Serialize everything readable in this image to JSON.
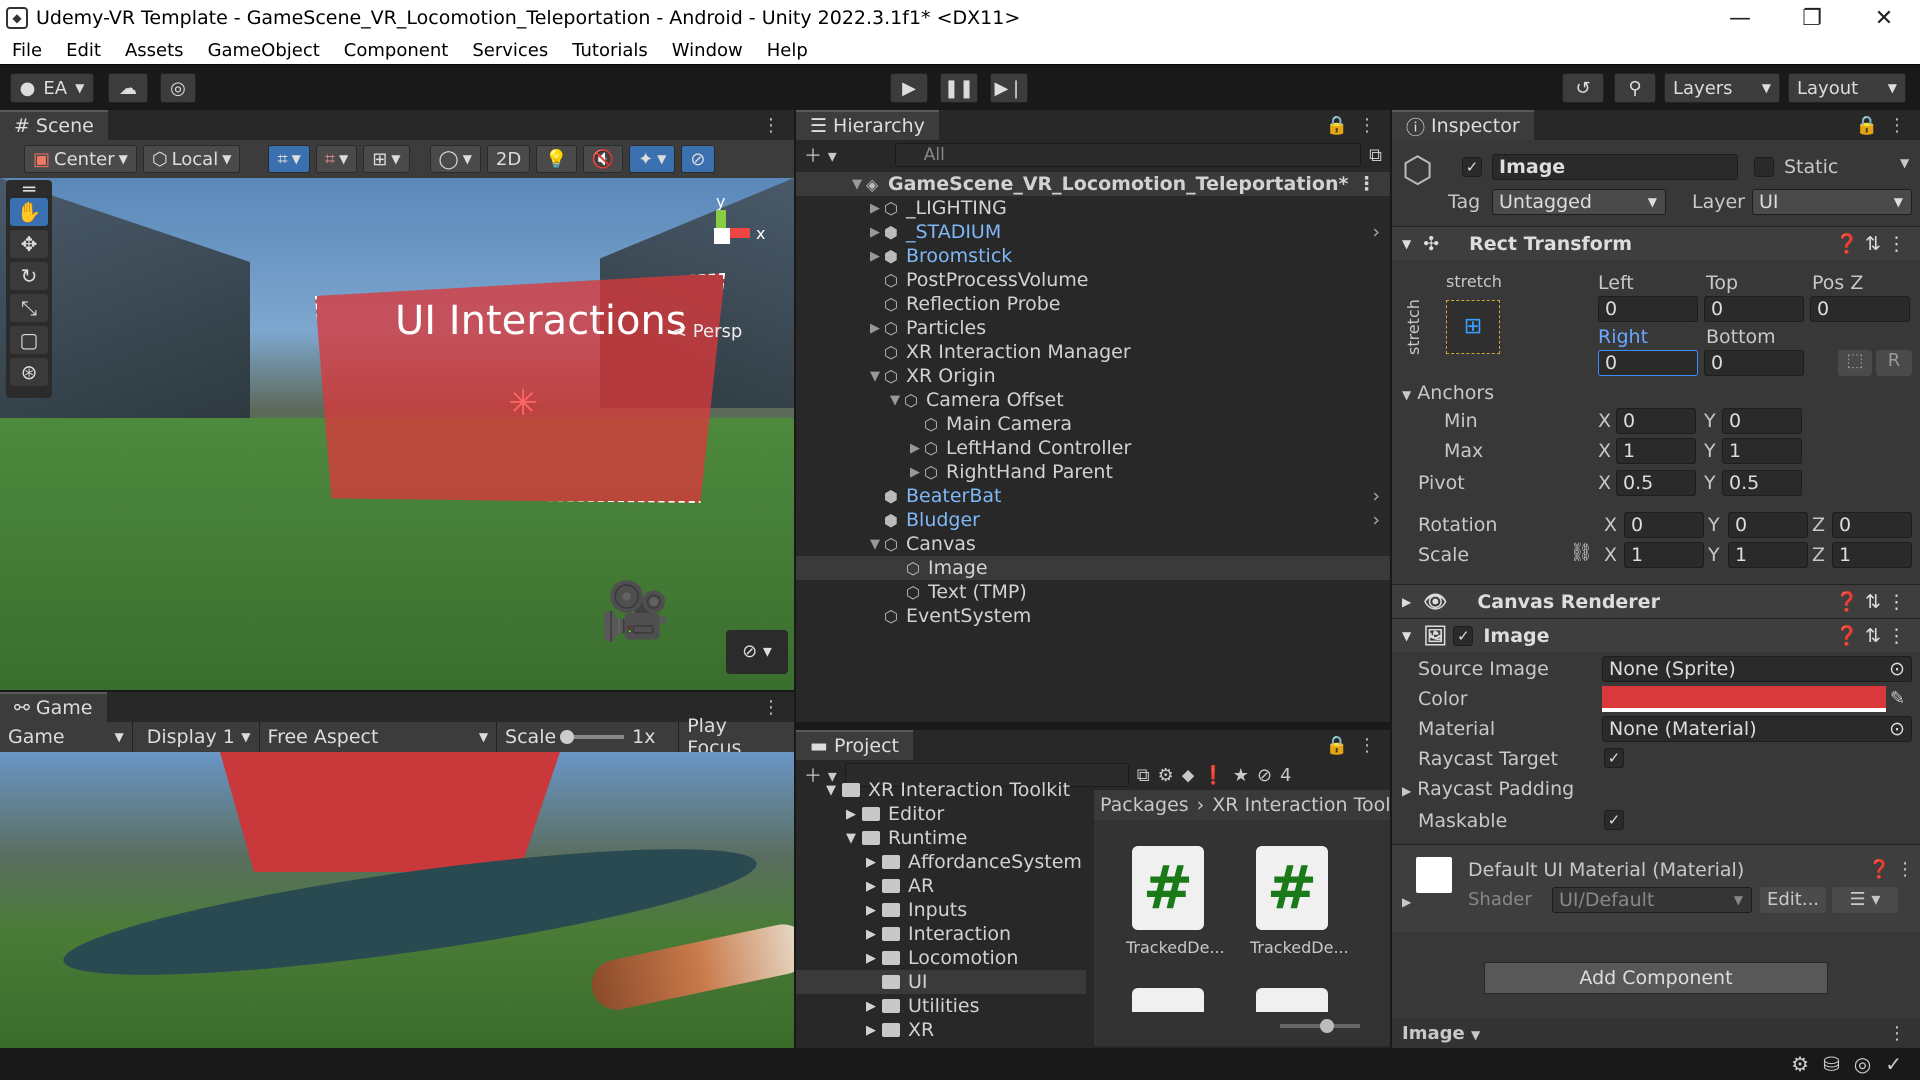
{
  "window": {
    "title": "Udemy-VR Template - GameScene_VR_Locomotion_Teleportation - Android - Unity 2022.3.1f1* <DX11>"
  },
  "menu": [
    "File",
    "Edit",
    "Assets",
    "GameObject",
    "Component",
    "Services",
    "Tutorials",
    "Window",
    "Help"
  ],
  "toolbar": {
    "account": "EA",
    "layers": "Layers",
    "layout": "Layout"
  },
  "scene": {
    "tab": "Scene",
    "pivot": "Center",
    "space": "Local",
    "mode2d": "2D",
    "persp": "< Persp",
    "canvas_text": "UI Interactions",
    "gizmo_x": "x",
    "gizmo_y": "y"
  },
  "game": {
    "tab": "Game",
    "mode": "Game",
    "display": "Display 1",
    "aspect": "Free Aspect",
    "scale_label": "Scale",
    "scale_value": "1x",
    "play_focus": "Play Focus"
  },
  "hierarchy": {
    "tab": "Hierarchy",
    "search": "All",
    "rows": [
      {
        "label": "GameScene_VR_Locomotion_Teleportation*"
      },
      {
        "label": "_LIGHTING"
      },
      {
        "label": "_STADIUM"
      },
      {
        "label": "Broomstick"
      },
      {
        "label": "PostProcessVolume"
      },
      {
        "label": "Reflection Probe"
      },
      {
        "label": "Particles"
      },
      {
        "label": "XR Interaction Manager"
      },
      {
        "label": "XR Origin"
      },
      {
        "label": "Camera Offset"
      },
      {
        "label": "Main Camera"
      },
      {
        "label": "LeftHand Controller"
      },
      {
        "label": "RightHand Parent"
      },
      {
        "label": "BeaterBat"
      },
      {
        "label": "Bludger"
      },
      {
        "label": "Canvas"
      },
      {
        "label": "Image"
      },
      {
        "label": "Text (TMP)"
      },
      {
        "label": "EventSystem"
      }
    ]
  },
  "project": {
    "tab": "Project",
    "hidden_count": "4",
    "breadcrumb": [
      "Packages",
      "XR Interaction Toolk"
    ],
    "tree": [
      "XR Interaction Toolkit",
      "Editor",
      "Runtime",
      "AffordanceSystem",
      "AR",
      "Inputs",
      "Interaction",
      "Locomotion",
      "UI",
      "Utilities",
      "XR"
    ],
    "assets": [
      "TrackedDe...",
      "TrackedDe..."
    ]
  },
  "inspector": {
    "tab": "Inspector",
    "object_name": "Image",
    "static_label": "Static",
    "tag_label": "Tag",
    "tag_value": "Untagged",
    "layer_label": "Layer",
    "layer_value": "UI",
    "rect": {
      "title": "Rect Transform",
      "stretch_h": "stretch",
      "stretch_v": "stretch",
      "left_label": "Left",
      "top_label": "Top",
      "posz_label": "Pos Z",
      "left": "0",
      "top": "0",
      "posz": "0",
      "right_label": "Right",
      "bottom_label": "Bottom",
      "right": "0",
      "bottom": "0",
      "anchors": "Anchors",
      "min": "Min",
      "max": "Max",
      "min_x": "0",
      "min_y": "0",
      "max_x": "1",
      "max_y": "1",
      "pivot": "Pivot",
      "pivot_x": "0.5",
      "pivot_y": "0.5",
      "rotation": "Rotation",
      "rot_x": "0",
      "rot_y": "0",
      "rot_z": "0",
      "scale": "Scale",
      "scale_x": "1",
      "scale_y": "1",
      "scale_z": "1",
      "x": "X",
      "y": "Y",
      "z": "Z",
      "r": "R"
    },
    "canvas_renderer": "Canvas Renderer",
    "image": {
      "title": "Image",
      "source_label": "Source Image",
      "source_value": "None (Sprite)",
      "color_label": "Color",
      "color": "#d9393b",
      "material_label": "Material",
      "material_value": "None (Material)",
      "raycast_target": "Raycast Target",
      "raycast_padding": "Raycast Padding",
      "maskable": "Maskable"
    },
    "material": {
      "title": "Default UI Material (Material)",
      "shader_label": "Shader",
      "shader_value": "UI/Default",
      "edit": "Edit..."
    },
    "add_component": "Add Component",
    "footer": "Image"
  }
}
